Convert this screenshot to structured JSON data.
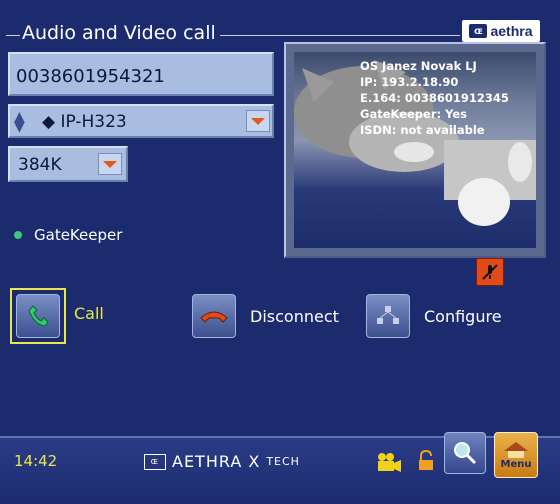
{
  "header": {
    "title": "Audio and Video call",
    "logo": {
      "mark": "ɶ",
      "text": "aethra"
    }
  },
  "call": {
    "number": "0038601954321",
    "protocol": "IP-H323",
    "rate": "384K"
  },
  "status": {
    "gatekeeper": "GateKeeper"
  },
  "video": {
    "lines": [
      "OS Janez Novak LJ",
      "IP: 193.2.18.90",
      "E.164: 0038601912345",
      "GateKeeper: Yes",
      "ISDN: not available"
    ]
  },
  "actions": {
    "call": "Call",
    "disconnect": "Disconnect",
    "configure": "Configure"
  },
  "footer": {
    "time": "14:42",
    "brand": {
      "mark": "ɶ",
      "main": "AETHRA X",
      "sub": "TECH"
    },
    "menu_label": "Menu"
  },
  "colors": {
    "background": "#1c2b6e",
    "accent": "#e8e84a",
    "field": "#a9bde0",
    "alert": "#e24a1a"
  }
}
